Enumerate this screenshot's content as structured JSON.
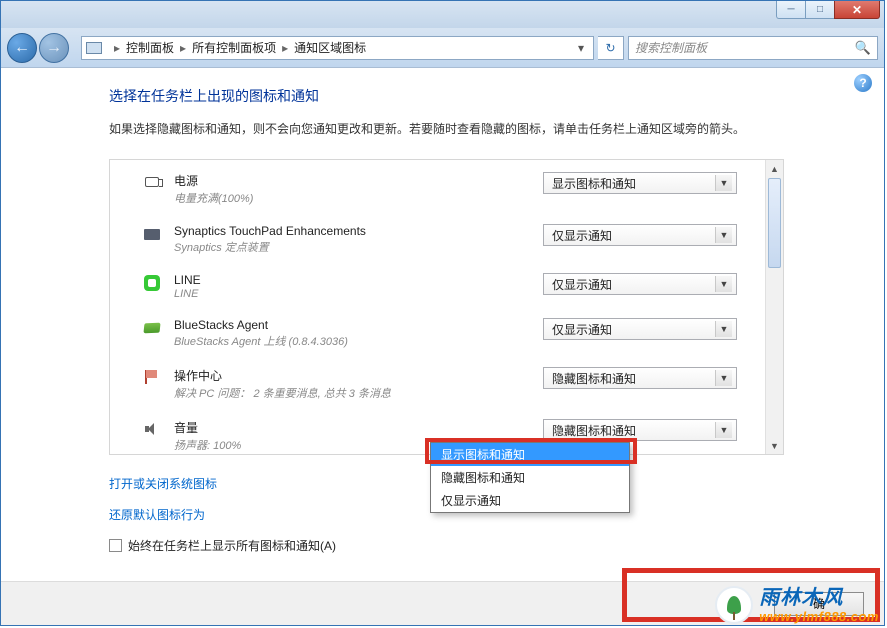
{
  "window": {
    "breadcrumb": {
      "a": "控制面板",
      "b": "所有控制面板项",
      "c": "通知区域图标"
    },
    "search_placeholder": "搜索控制面板"
  },
  "page": {
    "title": "选择在任务栏上出现的图标和通知",
    "desc": "如果选择隐藏图标和通知，则不会向您通知更改和更新。若要随时查看隐藏的图标，请单击任务栏上通知区域旁的箭头。"
  },
  "items": [
    {
      "name": "电源",
      "sub": "电量充满(100%)",
      "value": "显示图标和通知"
    },
    {
      "name": "Synaptics TouchPad Enhancements",
      "sub": "Synaptics 定点装置",
      "value": "仅显示通知"
    },
    {
      "name": "LINE",
      "sub": "LINE",
      "value": "仅显示通知"
    },
    {
      "name": "BlueStacks Agent",
      "sub": "BlueStacks Agent 上线 (0.8.4.3036)",
      "value": "仅显示通知"
    },
    {
      "name": "操作中心",
      "sub": "解决 PC 问题： 2 条重要消息, 总共 3 条消息",
      "value": "隐藏图标和通知"
    },
    {
      "name": "音量",
      "sub": "扬声器: 100%",
      "value": "隐藏图标和通知"
    }
  ],
  "dropdown_options": {
    "a": "显示图标和通知",
    "b": "隐藏图标和通知",
    "c": "仅显示通知"
  },
  "links": {
    "sys": "打开或关闭系统图标",
    "restore": "还原默认图标行为"
  },
  "checkbox_label": "始终在任务栏上显示所有图标和通知(A)",
  "buttons": {
    "ok": "确"
  },
  "watermark": {
    "cn": "雨林木风",
    "url": "www.ylmf888.com"
  }
}
